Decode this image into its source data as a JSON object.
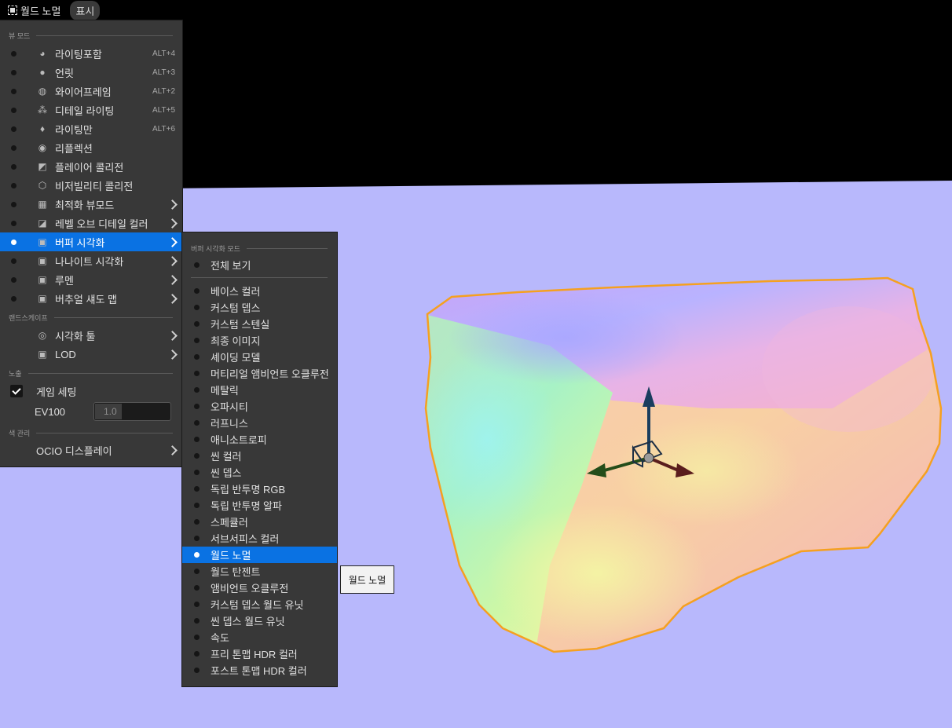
{
  "toolbar": {
    "viewmode_label": "월드 노멀",
    "show_label": "표시"
  },
  "menu": {
    "section_view_modes": "뷰 모드",
    "view_modes": [
      {
        "label": "라이팅포함",
        "shortcut": "ALT+4",
        "icon": "lit-sphere-icon"
      },
      {
        "label": "언릿",
        "shortcut": "ALT+3",
        "icon": "unlit-sphere-icon"
      },
      {
        "label": "와이어프레임",
        "shortcut": "ALT+2",
        "icon": "wireframe-sphere-icon"
      },
      {
        "label": "디테일 라이팅",
        "shortcut": "ALT+5",
        "icon": "detail-lighting-icon"
      },
      {
        "label": "라이팅만",
        "shortcut": "ALT+6",
        "icon": "lightbulb-icon"
      },
      {
        "label": "리플렉션",
        "shortcut": "",
        "icon": "reflection-icon"
      },
      {
        "label": "플레이어 콜리전",
        "shortcut": "",
        "icon": "player-collision-icon"
      },
      {
        "label": "비저빌리티 콜리전",
        "shortcut": "",
        "icon": "visibility-collision-icon"
      },
      {
        "label": "최적화 뷰모드",
        "shortcut": "",
        "icon": "optimization-grid-icon",
        "submenu": true
      },
      {
        "label": "레벨 오브 디테일 컬러",
        "shortcut": "",
        "icon": "lod-color-icon",
        "submenu": true
      },
      {
        "label": "버퍼 시각화",
        "shortcut": "",
        "icon": "buffer-visualization-icon",
        "submenu": true,
        "active": true
      },
      {
        "label": "나나이트 시각화",
        "shortcut": "",
        "icon": "nanite-visualization-icon",
        "submenu": true
      },
      {
        "label": "루멘",
        "shortcut": "",
        "icon": "lumen-icon",
        "submenu": true
      },
      {
        "label": "버추얼 섀도 맵",
        "shortcut": "",
        "icon": "virtual-shadow-map-icon",
        "submenu": true
      }
    ],
    "section_landscape": "랜드스케이프",
    "landscape_items": [
      {
        "label": "시각화 툴",
        "icon": "visualization-tools-icon"
      },
      {
        "label": "LOD",
        "icon": "lod-icon"
      }
    ],
    "section_exposure": "노출",
    "game_settings_label": "게임 세팅",
    "game_settings_checked": true,
    "ev100_label": "EV100",
    "ev100_value": "1.0",
    "section_color": "색 관리",
    "ocio_label": "OCIO 디스플레이"
  },
  "submenu": {
    "section_title": "버퍼 시각화 모드",
    "overview_label": "전체 보기",
    "items": [
      "베이스 컬러",
      "커스텀 뎁스",
      "커스텀 스텐실",
      "최종 이미지",
      "셰이딩 모델",
      "머티리얼 앰비언트 오클루전",
      "메탈릭",
      "오파시티",
      "러프니스",
      "애니소트로피",
      "씬 컬러",
      "씬 뎁스",
      "독립 반투명 RGB",
      "독립 반투명 알파",
      "스페큘러",
      "서브서피스 컬러",
      "월드 노멀",
      "월드 탄젠트",
      "앰비언트 오클루전",
      "커스텀 뎁스 월드 유닛",
      "씬 뎁스 월드 유닛",
      "속도",
      "프리 톤맵 HDR 컬러",
      "포스트 톤맵 HDR 컬러"
    ],
    "selected": "월드 노멀"
  },
  "tooltip": {
    "text": "월드 노멀"
  },
  "colors": {
    "accent": "#0a72e3",
    "menu_bg": "#383838",
    "viewport_bg": "#b8b8fc",
    "outline": "#f5a020"
  }
}
